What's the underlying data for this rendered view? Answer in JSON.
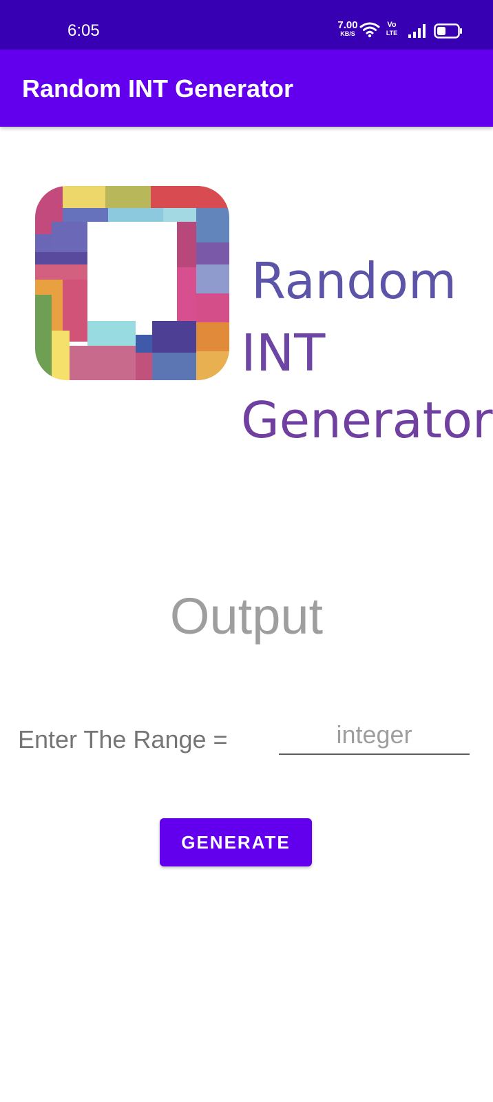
{
  "status_bar": {
    "time": "6:05",
    "network_speed_value": "7.00",
    "network_speed_unit": "KB/S",
    "volte_top": "Vo",
    "volte_bottom": "LTE",
    "icons": [
      "wifi-icon",
      "volte-icon",
      "signal-icon",
      "battery-icon"
    ],
    "background_color": "#3700b3"
  },
  "app_bar": {
    "title": "Random INT Generator",
    "background_color": "#6200ee"
  },
  "logo": {
    "icon": "colorful-square-frame-logo",
    "word_1": "Random",
    "word_2": "INT",
    "word_3": "Generator",
    "text_color": "#6a49a5"
  },
  "output": {
    "text": "Output"
  },
  "range": {
    "label": "Enter The Range =",
    "value": "",
    "placeholder": "integer"
  },
  "generate_button": {
    "label": "GENERATE",
    "color": "#6200ee"
  }
}
